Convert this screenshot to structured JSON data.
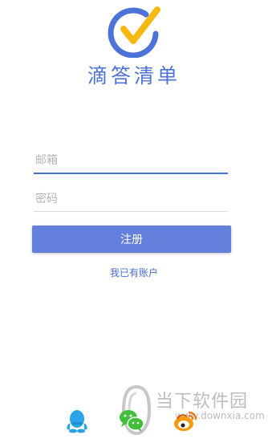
{
  "app": {
    "brand_name": "滴答清单",
    "accent_color": "#4d73d8",
    "check_color": "#f5b90f"
  },
  "form": {
    "email_placeholder": "邮箱",
    "email_value": "",
    "password_placeholder": "密码",
    "password_value": "",
    "register_label": "注册",
    "have_account_label": "我已有账户"
  },
  "social": {
    "icons": [
      "qq-icon",
      "wechat-icon",
      "weibo-icon"
    ]
  },
  "watermark": {
    "title": "当下软件园",
    "url": "www.downxia.com"
  }
}
